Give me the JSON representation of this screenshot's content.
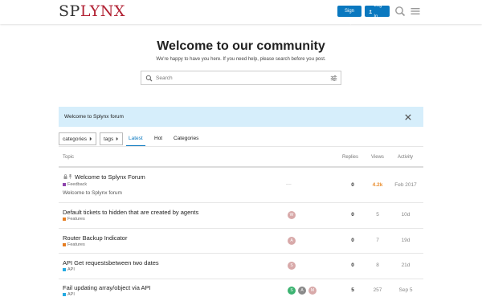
{
  "header": {
    "logo_sp": "SP",
    "logo_lynx": "LYNX",
    "signup_label": "Sign Up",
    "login_label": "Log In"
  },
  "hero": {
    "title": "Welcome to our community",
    "subtitle": "We're happy to have you here. If you need help, please search before you post.",
    "search_placeholder": "Search"
  },
  "banner": {
    "text": "Welcome to Splynx forum"
  },
  "nav": {
    "categories_dropdown": "categories",
    "tags_dropdown": "tags",
    "tabs": [
      "Latest",
      "Hot",
      "Categories"
    ],
    "active_tab": "Latest"
  },
  "columns": {
    "topic": "Topic",
    "replies": "Replies",
    "views": "Views",
    "activity": "Activity"
  },
  "topics": [
    {
      "title": "Welcome to Splynx Forum",
      "category": "Feedback",
      "category_color": "#8e44ad",
      "excerpt": "Welcome to Splynx forum",
      "posters": "----",
      "replies": "0",
      "views": "4.2k",
      "activity": "Feb 2017"
    },
    {
      "title": "Default tickets to hidden that are created by agents",
      "category": "Features",
      "category_color": "#e67e22",
      "posters": "",
      "replies": "0",
      "views": "5",
      "activity": "10d"
    },
    {
      "title": "Router Backup Indicator",
      "category": "Features",
      "category_color": "#e67e22",
      "posters": "",
      "replies": "0",
      "views": "7",
      "activity": "19d"
    },
    {
      "title": "API Get requestsbetween two dates",
      "category": "API",
      "category_color": "#25aae2",
      "posters": "",
      "replies": "0",
      "views": "8",
      "activity": "21d"
    },
    {
      "title": "Fail updating array/object via API",
      "category": "API",
      "category_color": "#25aae2",
      "posters": "",
      "replies": "5",
      "views": "257",
      "activity": "Sep 5"
    }
  ],
  "colors": {
    "brand": "#0a78bf",
    "logo_red": "#b22234",
    "banner_bg": "#d6eefb",
    "hot_views": "#e98c2d"
  },
  "icons": [
    "search-icon",
    "hamburger-menu-icon",
    "user-icon",
    "close-icon",
    "sliders-icon",
    "lock-icon",
    "pin-icon",
    "caret-right-icon"
  ]
}
